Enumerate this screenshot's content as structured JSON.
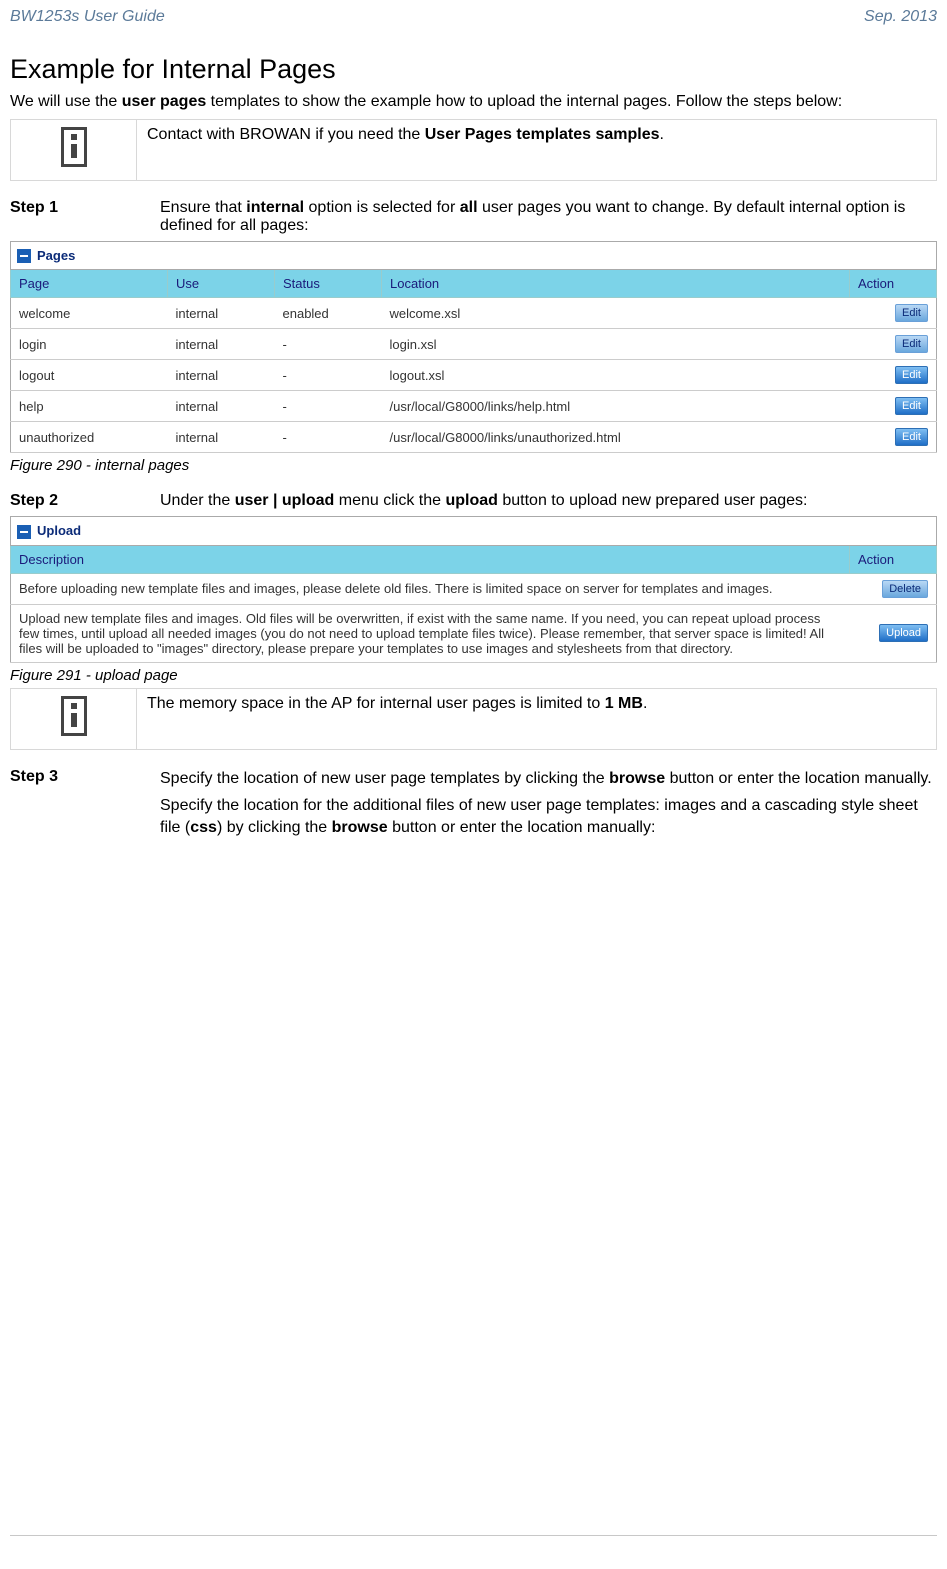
{
  "header": {
    "left": "BW1253s User Guide",
    "right": "Sep. 2013"
  },
  "title": "Example for Internal Pages",
  "intro_parts": {
    "a": "We will use the ",
    "b": "user pages",
    "c": " templates to show the example how to upload the internal pages. Follow the steps below:"
  },
  "info1": {
    "a": "Contact with BROWAN if you need the ",
    "b": "User Pages templates samples",
    "c": "."
  },
  "step1": {
    "label": "Step 1",
    "a": "Ensure that ",
    "b": "internal",
    "c": " option is selected for ",
    "d": "all",
    "e": " user pages you want to change. By default internal option is defined for all pages:"
  },
  "pages_table": {
    "title": "Pages",
    "headers": {
      "page": "Page",
      "use": "Use",
      "status": "Status",
      "location": "Location",
      "action": "Action"
    },
    "rows": [
      {
        "page": "welcome",
        "use": "internal",
        "status": "enabled",
        "location": "welcome.xsl",
        "action": "Edit"
      },
      {
        "page": "login",
        "use": "internal",
        "status": "-",
        "location": "login.xsl",
        "action": "Edit"
      },
      {
        "page": "logout",
        "use": "internal",
        "status": "-",
        "location": "logout.xsl",
        "action": "Edit"
      },
      {
        "page": "help",
        "use": "internal",
        "status": "-",
        "location": "/usr/local/G8000/links/help.html",
        "action": "Edit"
      },
      {
        "page": "unauthorized",
        "use": "internal",
        "status": "-",
        "location": "/usr/local/G8000/links/unauthorized.html",
        "action": "Edit"
      }
    ]
  },
  "fig1": "Figure 290 - internal pages",
  "step2": {
    "label": "Step 2",
    "a": "Under the ",
    "b": "user | upload",
    "c": " menu click the ",
    "d": "upload",
    "e": " button to upload new prepared user pages:"
  },
  "upload_table": {
    "title": "Upload",
    "headers": {
      "desc": "Description",
      "action": "Action"
    },
    "rows": [
      {
        "desc": "Before uploading new template files and images, please delete old files. There is limited space on server for templates and images.",
        "action": "Delete"
      },
      {
        "desc": "Upload new template files and images. Old files will be overwritten, if exist with the same name. If you need, you can repeat upload process few times, until upload all needed images (you do not need to upload template files twice). Please remember, that server space is limited! All files will be uploaded to \"images\" directory, please prepare your templates to use images and stylesheets from that directory.",
        "action": "Upload"
      }
    ]
  },
  "fig2": "Figure 291 - upload page",
  "info2": {
    "a": "The memory space in the AP for internal user pages is limited to ",
    "b": "1 MB",
    "c": "."
  },
  "step3": {
    "label": "Step 3",
    "p1a": "Specify the location of new user page templates by clicking the ",
    "p1b": "browse",
    "p1c": " button or enter the location manually.",
    "p2a": "Specify the location for the additional files of new user page templates: images and a cascading style sheet file (",
    "p2b": "css",
    "p2c": ") by clicking the ",
    "p2d": "browse",
    "p2e": " button or enter the location manually:"
  }
}
